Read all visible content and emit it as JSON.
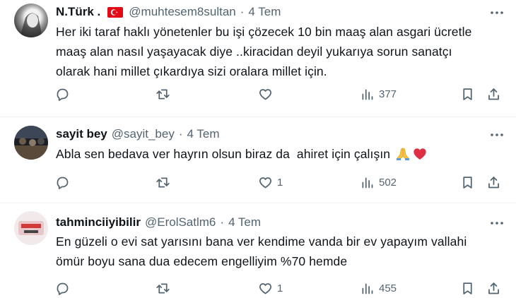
{
  "tweets": [
    {
      "name": "N.Türk .",
      "handle": "@muhtesem8sultan",
      "dot": "·",
      "time": "4 Tem",
      "flag": "turkey-flag",
      "lines": [
        "Her iki taraf haklı yönetenler bu işi çözecek 10 bin maaş alan asgari ücretle",
        "maaş alan nasıl yaşayacak diye ..kiracidan deyil yukarıya sorun sanatçı",
        "olarak hani millet çıkardıya  sizi oralara millet için."
      ],
      "likes": "",
      "views": "377"
    },
    {
      "name": "sayit bey",
      "handle": "@sayit_bey",
      "dot": "·",
      "time": "4 Tem",
      "lines": [
        "Abla sen bedava ver hayrın olsun biraz da  ahiret için çalışın "
      ],
      "emoji": [
        "folded-hands-emoji",
        "red-heart-emoji"
      ],
      "likes": "1",
      "views": "502"
    },
    {
      "name": "tahminciiyibilir",
      "handle": "@ErolSatlm6",
      "dot": "·",
      "time": "4 Tem",
      "lines": [
        "En güzeli o evi sat yarısını bana ver kendime vanda bir ev yapayım vallahi",
        "ömür boyu sana dua edecem engelliyim %70 hemde"
      ],
      "likes": "1",
      "views": "455"
    }
  ],
  "colors": {
    "text": "#0f1419",
    "secondary": "#536471",
    "divider": "#eff3f4",
    "heart": "#e0245e"
  }
}
